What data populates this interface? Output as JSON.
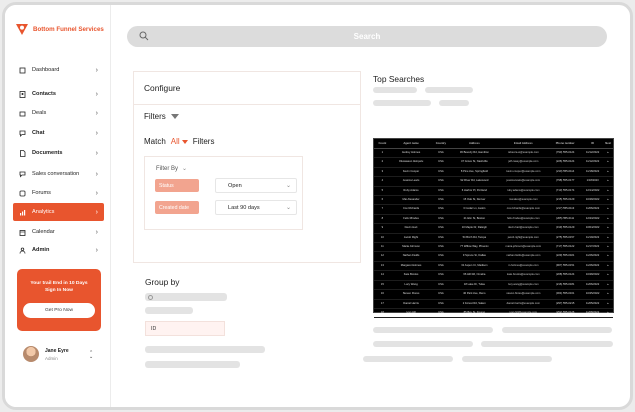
{
  "brand": {
    "name": "Bottom Funnel Services",
    "color": "#e8552e"
  },
  "nav": [
    {
      "label": "Dashboard",
      "icon": "dashboard-icon",
      "bold": false,
      "active": false
    },
    {
      "label": "Contacts",
      "icon": "contacts-icon",
      "bold": true,
      "active": false
    },
    {
      "label": "Deals",
      "icon": "deals-icon",
      "bold": false,
      "active": false
    },
    {
      "label": "Chat",
      "icon": "chat-icon",
      "bold": true,
      "active": false
    },
    {
      "label": "Documents",
      "icon": "documents-icon",
      "bold": true,
      "active": false
    },
    {
      "label": "Sales conversation",
      "icon": "sales-conversation-icon",
      "bold": false,
      "active": false
    },
    {
      "label": "Forums",
      "icon": "forums-icon",
      "bold": false,
      "active": false
    },
    {
      "label": "Analytics",
      "icon": "analytics-icon",
      "bold": false,
      "active": true
    },
    {
      "label": "Calendar",
      "icon": "calendar-icon",
      "bold": false,
      "active": false
    },
    {
      "label": "Admin",
      "icon": "admin-icon",
      "bold": true,
      "active": false
    }
  ],
  "promo": {
    "line1": "Your trail End in 10 Days",
    "line2": "Sign In Now",
    "button": "Get Pro Now"
  },
  "profile": {
    "name": "Jane Eyre",
    "role": "Admin"
  },
  "search": {
    "placeholder": "Search"
  },
  "configure": {
    "title": "Configure",
    "filters_label": "Filters",
    "match_prefix": "Match",
    "match_value": "All",
    "match_suffix": "Filters",
    "filter_by": "Filter By",
    "rows": [
      {
        "field": "Status",
        "value": "Open"
      },
      {
        "field": "Created date",
        "value": "Last 90 days"
      }
    ]
  },
  "group_by": {
    "title": "Group by",
    "id_label": "ID"
  },
  "top_searches": {
    "title": "Top Searches",
    "columns": [
      "Count",
      "Agent name",
      "Country",
      "Address",
      "Email Address",
      "Phone number",
      "ID",
      "Next"
    ],
    "rows": [
      [
        "1",
        "Audrey Holmes",
        "USA",
        "36 Beverly Rd, Hamilton",
        "rebecca.w@example.com",
        "(790) 555-0124",
        "11/12/2022",
        "▸"
      ],
      [
        "2",
        "Oluwaseun Akinpelu",
        "USA",
        "47 Grove St, Nashville",
        "jeff.casey@example.com",
        "(226) 555-0124",
        "11/12/2022",
        "▸"
      ],
      [
        "3",
        "Kevin Cooper",
        "USA",
        "8 Pine Ave, Springfield",
        "kevin.cooper@example.com",
        "(219) 555-0114",
        "11/18/2022",
        "▸"
      ],
      [
        "4",
        "Jessica Lewis",
        "USA",
        "92 River Rd, Lakewood",
        "jessica.lewis@example.com",
        "(798) 555-0177",
        "1/18/2023",
        "▸"
      ],
      [
        "5",
        "Ruby Adams",
        "USA",
        "6 Harbor Pl, Portland",
        "ruby.adams@example.com",
        "(713) 555-0174",
        "12/14/2022",
        "▸"
      ],
      [
        "6",
        "Mai Alexander",
        "USA",
        "15 Oak St, Denver",
        "mai.alex@example.com",
        "(215) 555-0129",
        "10/28/2022",
        "▸"
      ],
      [
        "7",
        "Cox Richards",
        "USA",
        "3 Cedar Ln, Austin",
        "cox.richards@example.com",
        "(217) 555-0113",
        "11/06/2022",
        "▸"
      ],
      [
        "8",
        "Felix Rhodes",
        "USA",
        "21 Elm St, Boston",
        "felix.rhodes@example.com",
        "(205) 555-0111",
        "12/23/2022",
        "▸"
      ],
      [
        "9",
        "Devin Hart",
        "USA",
        "10 Maple Dr, Raleigh",
        "devin.hart@example.com",
        "(319) 555-0129",
        "10/04/2022",
        "▸"
      ],
      [
        "10",
        "Jacob Right",
        "USA",
        "54 Birch Rd, Tampa",
        "jacob.right@example.com",
        "(275) 555-0157",
        "11/19/2022",
        "▸"
      ],
      [
        "11",
        "Maria Johnson",
        "USA",
        "77 Willow Way, Phoenix",
        "maria.johnson@example.com",
        "(717) 555-0122",
        "11/17/2022",
        "▸"
      ],
      [
        "12",
        "Nathan Fields",
        "USA",
        "9 Spruce St, Dallas",
        "nathan.fields@example.com",
        "(229) 555-0321",
        "11/26/2022",
        "▸"
      ],
      [
        "13",
        "Margaret Holmes",
        "USA",
        "31 Aspen Ct, Madison",
        "m.holmes@example.com",
        "(907) 555-0151",
        "11/26/2022",
        "▸"
      ],
      [
        "14",
        "Kate Brooks",
        "USA",
        "66 Hill Rd, Omaha",
        "kate.brooks@example.com",
        "(208) 555-0124",
        "10/28/2022",
        "▸"
      ],
      [
        "15",
        "Lucy Wang",
        "USA",
        "18 Lake Dr, Tulsa",
        "lucy.wang@example.com",
        "(216) 555-0181",
        "11/06/2022",
        "▸"
      ],
      [
        "16",
        "Steven Flores",
        "USA",
        "40 Park Ave, Reno",
        "steven.flores@example.com",
        "(304) 555-0161",
        "10/25/2022",
        "▸"
      ],
      [
        "17",
        "Daniel Harris",
        "USA",
        "2 Forest Rd, Salem",
        "daniel.harris@example.com",
        "(297) 555-0215",
        "11/05/2022",
        "▸"
      ],
      [
        "18",
        "Ivan Hill",
        "USA",
        "85 Bay St, Fresno",
        "ivan.hill@example.com",
        "(252) 555-0126",
        "11/08/2022",
        "▸"
      ]
    ]
  }
}
